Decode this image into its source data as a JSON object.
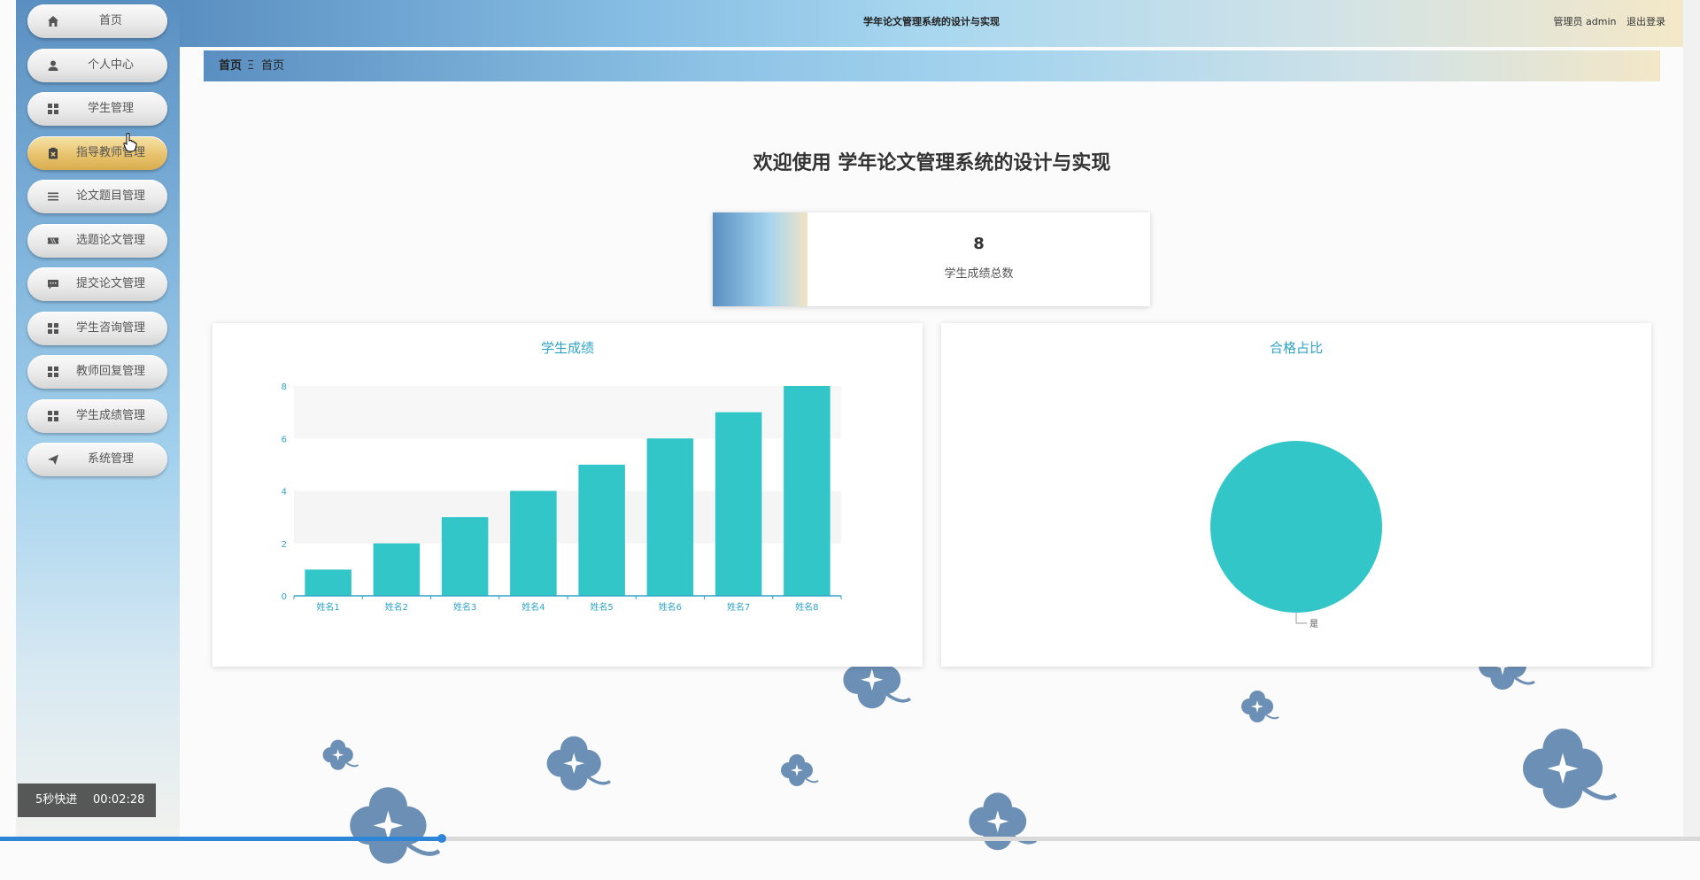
{
  "app": {
    "title": "学年论文管理系统的设计与实现",
    "user_label": "管理员 admin",
    "logout_label": "退出登录"
  },
  "sidebar": {
    "items": [
      {
        "label": "首页",
        "icon": "home-icon",
        "active": false
      },
      {
        "label": "个人中心",
        "icon": "user-icon",
        "active": false
      },
      {
        "label": "学生管理",
        "icon": "grid-icon",
        "active": false
      },
      {
        "label": "指导教师管理",
        "icon": "clipboard-icon",
        "active": true
      },
      {
        "label": "论文题目管理",
        "icon": "list-icon",
        "active": false
      },
      {
        "label": "选题论文管理",
        "icon": "ticket-icon",
        "active": false
      },
      {
        "label": "提交论文管理",
        "icon": "comment-icon",
        "active": false
      },
      {
        "label": "学生咨询管理",
        "icon": "grid-icon",
        "active": false
      },
      {
        "label": "教师回复管理",
        "icon": "grid-icon",
        "active": false
      },
      {
        "label": "学生成绩管理",
        "icon": "grid-icon",
        "active": false
      },
      {
        "label": "系统管理",
        "icon": "send-icon",
        "active": false
      }
    ]
  },
  "breadcrumb": {
    "home": "首页",
    "separator": "Ξ",
    "current": "首页"
  },
  "welcome": {
    "text": "欢迎使用 学年论文管理系统的设计与实现"
  },
  "stat": {
    "value": "8",
    "label": "学生成绩总数"
  },
  "colors": {
    "bar": "#33c6c8",
    "accent_text": "#2fa3c6",
    "flower": "#6b8fb5"
  },
  "chart_data": [
    {
      "type": "bar",
      "title": "学生成绩",
      "categories": [
        "姓名1",
        "姓名2",
        "姓名3",
        "姓名4",
        "姓名5",
        "姓名6",
        "姓名7",
        "姓名8"
      ],
      "values": [
        1,
        2,
        3,
        4,
        5,
        6,
        7,
        8
      ],
      "yticks": [
        "0",
        "2",
        "4",
        "6",
        "8"
      ],
      "ylim": [
        0,
        8
      ],
      "grid": "banded"
    },
    {
      "type": "pie",
      "title": "合格占比",
      "slices": [
        {
          "label": "是",
          "value": 1
        }
      ]
    }
  ],
  "video": {
    "speed_label": "5秒快进",
    "time": "00:02:28",
    "progress": 0.26
  }
}
